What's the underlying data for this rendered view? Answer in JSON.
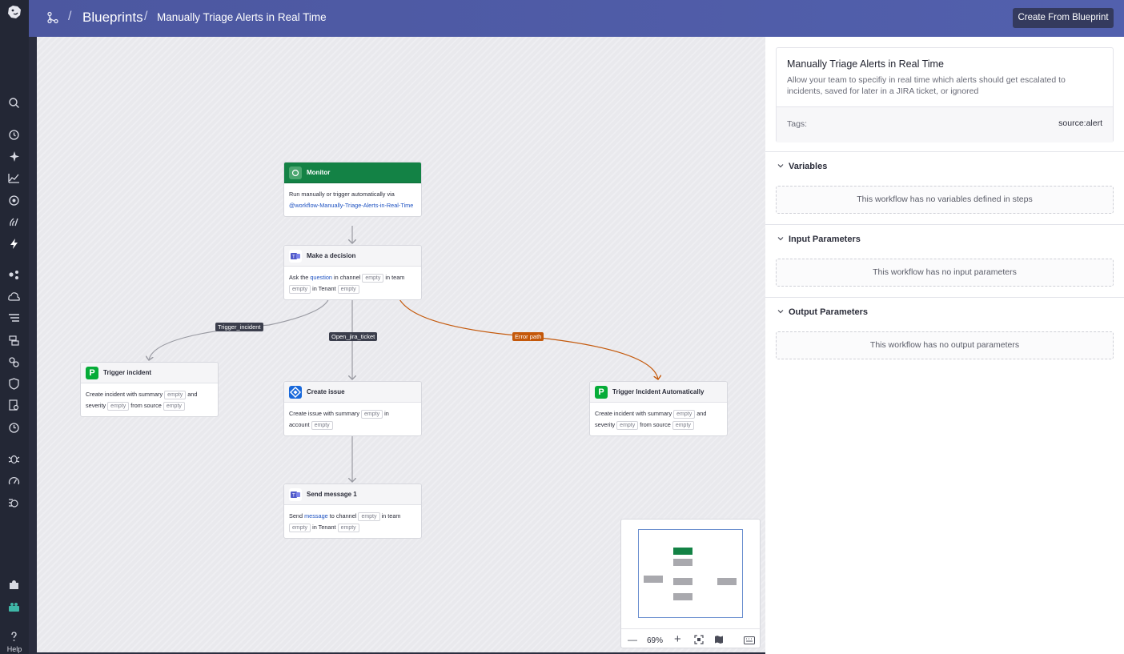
{
  "header": {
    "breadcrumb_root": "Blueprints",
    "separator": "/",
    "title": "Manually Triage Alerts in Real Time",
    "create_button": "Create From Blueprint"
  },
  "rail": {
    "help_label": "Help",
    "icons": [
      "dog-logo-icon",
      "search-icon",
      "history-icon",
      "sparkle-icon",
      "chart-icon",
      "target-icon",
      "signal-icon",
      "bolt-icon",
      "dots-icon",
      "cloud-icon",
      "list-icon",
      "apm-icon",
      "link-icon",
      "shield-icon",
      "search-doc-icon",
      "cycle-icon",
      "bug-icon",
      "gauge-icon",
      "synthetics-icon",
      "puzzle-icon",
      "integration-icon",
      "help-icon"
    ]
  },
  "workflow": {
    "nodes": {
      "monitor": {
        "title": "Monitor",
        "text": "Run manually or trigger automatically via",
        "link": "@workflow-Manually-Triage-Alerts-in-Real-Time"
      },
      "decision": {
        "title": "Make a decision",
        "t1": "Ask the",
        "link": "question",
        "t2": "in channel",
        "chip": "empty",
        "t3": "in team",
        "t4": "in Tenant"
      },
      "trigger": {
        "title": "Trigger incident",
        "t1": "Create incident with summary",
        "chip": "empty",
        "t2": "and",
        "t3": "severity",
        "t4": "from source"
      },
      "issue": {
        "title": "Create issue",
        "t1": "Create issue with summary",
        "chip": "empty",
        "t2": "in",
        "t3": "account"
      },
      "auto": {
        "title": "Trigger Incident Automatically",
        "t1": "Create incident with summary",
        "chip": "empty",
        "t2": "and",
        "t3": "severity",
        "t4": "from source"
      },
      "send": {
        "title": "Send message 1",
        "t1": "Send",
        "link": "message",
        "t2": "to channel",
        "chip": "empty",
        "t3": "in team",
        "t4": "in Tenant"
      }
    },
    "edge_labels": {
      "trigger": "Trigger_incident",
      "jira": "Open_jira_ticket",
      "error": "Error path"
    },
    "colors": {
      "monitor_header": "#138245",
      "error_edge": "#c4580a",
      "edge": "#9a9ba3"
    }
  },
  "minimap": {
    "zoom": "69%",
    "controls": [
      "minus-icon",
      "plus-icon",
      "fit-view-icon",
      "map-icon",
      "keyboard-icon"
    ]
  },
  "panel": {
    "title": "Manually Triage Alerts in Real Time",
    "description": "Allow your team to specifiy in real time which alerts should get escalated to incidents, saved for later in a JIRA ticket, or ignored",
    "tags_label": "Tags:",
    "tag": "source:alert",
    "variables": {
      "heading": "Variables",
      "empty": "This workflow has no variables defined in steps"
    },
    "inputs": {
      "heading": "Input Parameters",
      "empty": "This workflow has no input parameters"
    },
    "outputs": {
      "heading": "Output Parameters",
      "empty": "This workflow has no output parameters"
    }
  }
}
